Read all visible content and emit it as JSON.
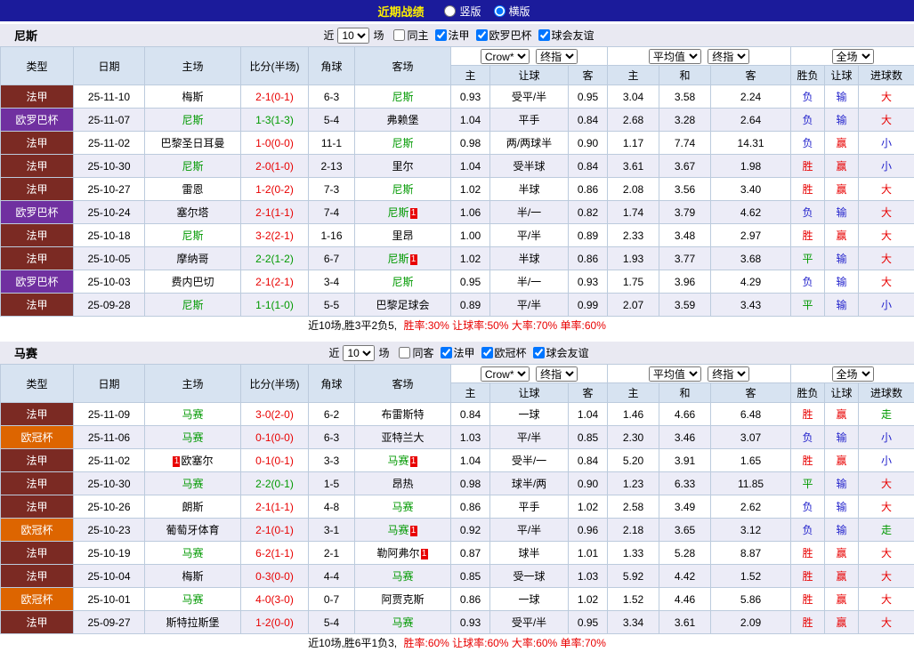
{
  "colors": {
    "topbar": "#1B1B9B",
    "title": "#FFF000",
    "ligue1": "#7B2A23",
    "europa": "#7030A0",
    "ucl": "#DD6500",
    "win": "#E80000",
    "draw": "#009900",
    "loss": "#2323CC",
    "focal_team": "#009900",
    "header_bg": "#D7E3F1",
    "alt_row_bg": "#ECECF7",
    "band_bg": "#E9E9F2"
  },
  "topbar": {
    "title": "近期战绩",
    "radios": [
      {
        "label": "竖版",
        "checked": false
      },
      {
        "label": "横版",
        "checked": true
      }
    ]
  },
  "labels": {
    "near": "近",
    "games": "场"
  },
  "columns": {
    "type": "类型",
    "date": "日期",
    "home": "主场",
    "score": "比分(半场)",
    "corner": "角球",
    "away": "客场",
    "h": "主",
    "hc": "让球",
    "a": "客",
    "eh": "主",
    "ed": "和",
    "ea": "客",
    "wl": "胜负",
    "hc2": "让球",
    "goals": "进球数"
  },
  "sections": [
    {
      "team": "尼斯",
      "filter": {
        "count": "10",
        "checks": [
          {
            "label": "同主",
            "checked": false
          },
          {
            "label": "法甲",
            "checked": true
          },
          {
            "label": "欧罗巴杯",
            "checked": true
          },
          {
            "label": "球会友谊",
            "checked": true
          }
        ]
      },
      "selects": {
        "bookmaker": "Crow*",
        "final": "终指",
        "average": "平均值",
        "final2": "终指",
        "scope": "全场"
      },
      "rows": [
        {
          "league": "法甲",
          "date": "25-11-10",
          "home": "梅斯",
          "score": "2-1(0-1)",
          "score_c": "red",
          "corner": "6-3",
          "away": "尼斯",
          "away_green": true,
          "a_home": "0.93",
          "handicap": "受平/半",
          "a_away": "0.95",
          "e_home": "3.04",
          "e_draw": "3.58",
          "e_away": "2.24",
          "wl": "负",
          "wl_c": "blue",
          "hc": "输",
          "hc_c": "blue",
          "gl": "大",
          "gl_c": "red"
        },
        {
          "league": "欧罗巴杯",
          "date": "25-11-07",
          "home": "尼斯",
          "home_green": true,
          "score": "1-3(1-3)",
          "score_c": "green",
          "corner": "5-4",
          "away": "弗赖堡",
          "a_home": "1.04",
          "handicap": "平手",
          "a_away": "0.84",
          "e_home": "2.68",
          "e_draw": "3.28",
          "e_away": "2.64",
          "wl": "负",
          "wl_c": "blue",
          "hc": "输",
          "hc_c": "blue",
          "gl": "大",
          "gl_c": "red"
        },
        {
          "league": "法甲",
          "date": "25-11-02",
          "home": "巴黎圣日耳曼",
          "score": "1-0(0-0)",
          "score_c": "red",
          "corner": "11-1",
          "away": "尼斯",
          "away_green": true,
          "a_home": "0.98",
          "handicap": "两/两球半",
          "a_away": "0.90",
          "e_home": "1.17",
          "e_draw": "7.74",
          "e_away": "14.31",
          "wl": "负",
          "wl_c": "blue",
          "hc": "赢",
          "hc_c": "red",
          "gl": "小",
          "gl_c": "blue"
        },
        {
          "league": "法甲",
          "date": "25-10-30",
          "home": "尼斯",
          "home_green": true,
          "score": "2-0(1-0)",
          "score_c": "red",
          "corner": "2-13",
          "away": "里尔",
          "a_home": "1.04",
          "handicap": "受半球",
          "a_away": "0.84",
          "e_home": "3.61",
          "e_draw": "3.67",
          "e_away": "1.98",
          "wl": "胜",
          "wl_c": "red",
          "hc": "赢",
          "hc_c": "red",
          "gl": "小",
          "gl_c": "blue"
        },
        {
          "league": "法甲",
          "date": "25-10-27",
          "home": "雷恩",
          "score": "1-2(0-2)",
          "score_c": "red",
          "corner": "7-3",
          "away": "尼斯",
          "away_green": true,
          "a_home": "1.02",
          "handicap": "半球",
          "a_away": "0.86",
          "e_home": "2.08",
          "e_draw": "3.56",
          "e_away": "3.40",
          "wl": "胜",
          "wl_c": "red",
          "hc": "赢",
          "hc_c": "red",
          "gl": "大",
          "gl_c": "red"
        },
        {
          "league": "欧罗巴杯",
          "date": "25-10-24",
          "home": "塞尔塔",
          "score": "2-1(1-1)",
          "score_c": "red",
          "corner": "7-4",
          "away": "尼斯",
          "away_green": true,
          "away_b2": "1",
          "a_home": "1.06",
          "handicap": "半/一",
          "a_away": "0.82",
          "e_home": "1.74",
          "e_draw": "3.79",
          "e_away": "4.62",
          "wl": "负",
          "wl_c": "blue",
          "hc": "输",
          "hc_c": "blue",
          "gl": "大",
          "gl_c": "red"
        },
        {
          "league": "法甲",
          "date": "25-10-18",
          "home": "尼斯",
          "home_green": true,
          "score": "3-2(2-1)",
          "score_c": "red",
          "corner": "1-16",
          "away": "里昂",
          "a_home": "1.00",
          "handicap": "平/半",
          "a_away": "0.89",
          "e_home": "2.33",
          "e_draw": "3.48",
          "e_away": "2.97",
          "wl": "胜",
          "wl_c": "red",
          "hc": "赢",
          "hc_c": "red",
          "gl": "大",
          "gl_c": "red"
        },
        {
          "league": "法甲",
          "date": "25-10-05",
          "home": "摩纳哥",
          "score": "2-2(1-2)",
          "score_c": "green",
          "corner": "6-7",
          "away": "尼斯",
          "away_green": true,
          "away_b2": "1",
          "a_home": "1.02",
          "handicap": "半球",
          "a_away": "0.86",
          "e_home": "1.93",
          "e_draw": "3.77",
          "e_away": "3.68",
          "wl": "平",
          "wl_c": "green",
          "hc": "输",
          "hc_c": "blue",
          "gl": "大",
          "gl_c": "red"
        },
        {
          "league": "欧罗巴杯",
          "date": "25-10-03",
          "home": "费内巴切",
          "score": "2-1(2-1)",
          "score_c": "red",
          "corner": "3-4",
          "away": "尼斯",
          "away_green": true,
          "a_home": "0.95",
          "handicap": "半/一",
          "a_away": "0.93",
          "e_home": "1.75",
          "e_draw": "3.96",
          "e_away": "4.29",
          "wl": "负",
          "wl_c": "blue",
          "hc": "输",
          "hc_c": "blue",
          "gl": "大",
          "gl_c": "red"
        },
        {
          "league": "法甲",
          "date": "25-09-28",
          "home": "尼斯",
          "home_green": true,
          "score": "1-1(1-0)",
          "score_c": "green",
          "corner": "5-5",
          "away": "巴黎足球会",
          "a_home": "0.89",
          "handicap": "平/半",
          "a_away": "0.99",
          "e_home": "2.07",
          "e_draw": "3.59",
          "e_away": "3.43",
          "wl": "平",
          "wl_c": "green",
          "hc": "输",
          "hc_c": "blue",
          "gl": "小",
          "gl_c": "blue"
        }
      ],
      "summary": {
        "record": "近10场,胜3平2负5,",
        "rates": "胜率:30% 让球率:50% 大率:70% 单率:60%"
      }
    },
    {
      "team": "马赛",
      "filter": {
        "count": "10",
        "checks": [
          {
            "label": "同客",
            "checked": false
          },
          {
            "label": "法甲",
            "checked": true
          },
          {
            "label": "欧冠杯",
            "checked": true
          },
          {
            "label": "球会友谊",
            "checked": true
          }
        ]
      },
      "selects": {
        "bookmaker": "Crow*",
        "final": "终指",
        "average": "平均值",
        "final2": "终指",
        "scope": "全场"
      },
      "rows": [
        {
          "league": "法甲",
          "date": "25-11-09",
          "home": "马赛",
          "home_green": true,
          "score": "3-0(2-0)",
          "score_c": "red",
          "corner": "6-2",
          "away": "布雷斯特",
          "a_home": "0.84",
          "handicap": "一球",
          "a_away": "1.04",
          "e_home": "1.46",
          "e_draw": "4.66",
          "e_away": "6.48",
          "wl": "胜",
          "wl_c": "red",
          "hc": "赢",
          "hc_c": "red",
          "gl": "走",
          "gl_c": "green"
        },
        {
          "league": "欧冠杯",
          "date": "25-11-06",
          "home": "马赛",
          "home_green": true,
          "score": "0-1(0-0)",
          "score_c": "red",
          "corner": "6-3",
          "away": "亚特兰大",
          "a_home": "1.03",
          "handicap": "平/半",
          "a_away": "0.85",
          "e_home": "2.30",
          "e_draw": "3.46",
          "e_away": "3.07",
          "wl": "负",
          "wl_c": "blue",
          "hc": "输",
          "hc_c": "blue",
          "gl": "小",
          "gl_c": "blue"
        },
        {
          "league": "法甲",
          "date": "25-11-02",
          "home": "欧塞尔",
          "home_b1": "1",
          "score": "0-1(0-1)",
          "score_c": "red",
          "corner": "3-3",
          "away": "马赛",
          "away_green": true,
          "away_b2": "1",
          "a_home": "1.04",
          "handicap": "受半/一",
          "a_away": "0.84",
          "e_home": "5.20",
          "e_draw": "3.91",
          "e_away": "1.65",
          "wl": "胜",
          "wl_c": "red",
          "hc": "赢",
          "hc_c": "red",
          "gl": "小",
          "gl_c": "blue"
        },
        {
          "league": "法甲",
          "date": "25-10-30",
          "home": "马赛",
          "home_green": true,
          "score": "2-2(0-1)",
          "score_c": "green",
          "corner": "1-5",
          "away": "昂热",
          "a_home": "0.98",
          "handicap": "球半/两",
          "a_away": "0.90",
          "e_home": "1.23",
          "e_draw": "6.33",
          "e_away": "11.85",
          "wl": "平",
          "wl_c": "green",
          "hc": "输",
          "hc_c": "blue",
          "gl": "大",
          "gl_c": "red"
        },
        {
          "league": "法甲",
          "date": "25-10-26",
          "home": "朗斯",
          "score": "2-1(1-1)",
          "score_c": "red",
          "corner": "4-8",
          "away": "马赛",
          "away_green": true,
          "a_home": "0.86",
          "handicap": "平手",
          "a_away": "1.02",
          "e_home": "2.58",
          "e_draw": "3.49",
          "e_away": "2.62",
          "wl": "负",
          "wl_c": "blue",
          "hc": "输",
          "hc_c": "blue",
          "gl": "大",
          "gl_c": "red"
        },
        {
          "league": "欧冠杯",
          "date": "25-10-23",
          "home": "葡萄牙体育",
          "score": "2-1(0-1)",
          "score_c": "red",
          "corner": "3-1",
          "away": "马赛",
          "away_green": true,
          "away_b2": "1",
          "a_home": "0.92",
          "handicap": "平/半",
          "a_away": "0.96",
          "e_home": "2.18",
          "e_draw": "3.65",
          "e_away": "3.12",
          "wl": "负",
          "wl_c": "blue",
          "hc": "输",
          "hc_c": "blue",
          "gl": "走",
          "gl_c": "green"
        },
        {
          "league": "法甲",
          "date": "25-10-19",
          "home": "马赛",
          "home_green": true,
          "score": "6-2(1-1)",
          "score_c": "red",
          "corner": "2-1",
          "away": "勒阿弗尔",
          "away_b2": "1",
          "a_home": "0.87",
          "handicap": "球半",
          "a_away": "1.01",
          "e_home": "1.33",
          "e_draw": "5.28",
          "e_away": "8.87",
          "wl": "胜",
          "wl_c": "red",
          "hc": "赢",
          "hc_c": "red",
          "gl": "大",
          "gl_c": "red"
        },
        {
          "league": "法甲",
          "date": "25-10-04",
          "home": "梅斯",
          "score": "0-3(0-0)",
          "score_c": "red",
          "corner": "4-4",
          "away": "马赛",
          "away_green": true,
          "a_home": "0.85",
          "handicap": "受一球",
          "a_away": "1.03",
          "e_home": "5.92",
          "e_draw": "4.42",
          "e_away": "1.52",
          "wl": "胜",
          "wl_c": "red",
          "hc": "赢",
          "hc_c": "red",
          "gl": "大",
          "gl_c": "red"
        },
        {
          "league": "欧冠杯",
          "date": "25-10-01",
          "home": "马赛",
          "home_green": true,
          "score": "4-0(3-0)",
          "score_c": "red",
          "corner": "0-7",
          "away": "阿贾克斯",
          "a_home": "0.86",
          "handicap": "一球",
          "a_away": "1.02",
          "e_home": "1.52",
          "e_draw": "4.46",
          "e_away": "5.86",
          "wl": "胜",
          "wl_c": "red",
          "hc": "赢",
          "hc_c": "red",
          "gl": "大",
          "gl_c": "red"
        },
        {
          "league": "法甲",
          "date": "25-09-27",
          "home": "斯特拉斯堡",
          "score": "1-2(0-0)",
          "score_c": "red",
          "corner": "5-4",
          "away": "马赛",
          "away_green": true,
          "a_home": "0.93",
          "handicap": "受平/半",
          "a_away": "0.95",
          "e_home": "3.34",
          "e_draw": "3.61",
          "e_away": "2.09",
          "wl": "胜",
          "wl_c": "red",
          "hc": "赢",
          "hc_c": "red",
          "gl": "大",
          "gl_c": "red"
        }
      ],
      "summary": {
        "record": "近10场,胜6平1负3,",
        "rates": "胜率:60% 让球率:60% 大率:60% 单率:70%"
      }
    }
  ]
}
